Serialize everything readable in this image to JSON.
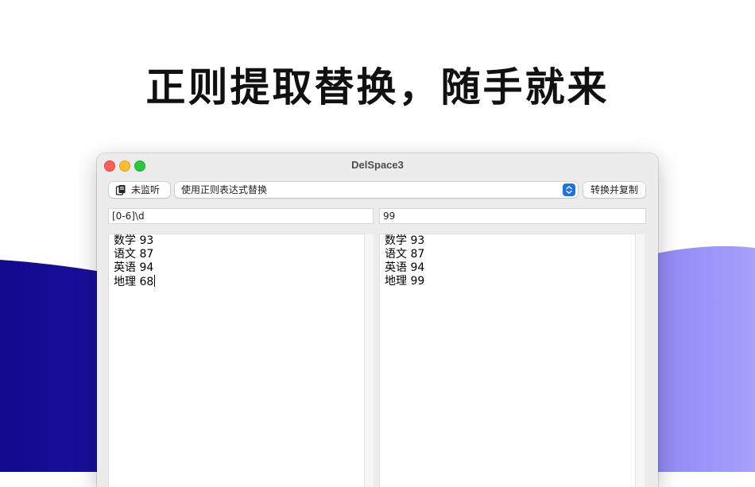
{
  "headline": "正则提取替换，随手就来",
  "window": {
    "title": "DelSpace3",
    "listen_button": "未监听",
    "mode_select": "使用正则表达式替换",
    "convert_button": "转换并复制",
    "pattern_field": "[0-6]\\d",
    "replacement_field": "99",
    "input_lines": [
      "数学 93",
      "语文 87",
      "英语 94",
      "地理 68"
    ],
    "output_lines": [
      "数学 93",
      "语文 87",
      "英语 94",
      "地理 99"
    ]
  },
  "colors": {
    "wave_dark": "#12098f",
    "wave_light": "#a29dfb",
    "select_accent": "#1a73e8"
  },
  "icons": {
    "clipboard": "clipboard-icon",
    "select_arrows": "up-down-chevron-icon"
  }
}
